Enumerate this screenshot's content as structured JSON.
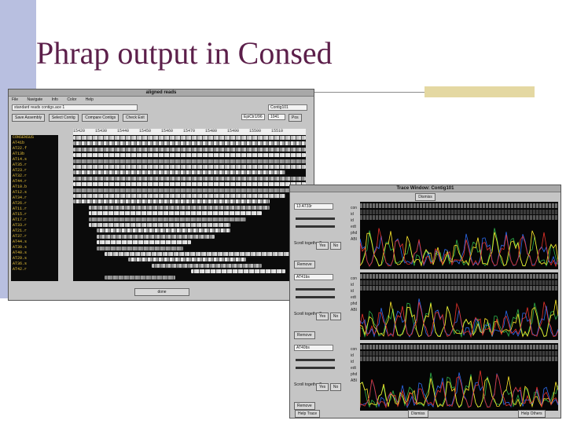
{
  "slide": {
    "title": "Phrap output in Consed"
  },
  "aligned_window": {
    "title": "aligned reads",
    "menu": [
      "File",
      "Navigate",
      "Info",
      "Color",
      "Help"
    ],
    "project_field": "standard reads contigs.ace 1",
    "contig_field": "Contig101",
    "buttons": [
      "Save Assembly",
      "Select Contig",
      "Compare Contigs",
      "Check Exit"
    ],
    "position_field": "EpiCtr1/96",
    "position_value": "1041",
    "position_button": "Pos",
    "ruler": [
      "15420",
      "15430",
      "15440",
      "15450",
      "15460",
      "15470",
      "15480",
      "15490",
      "15500",
      "15510"
    ],
    "read_names": [
      "CONSENSUS",
      "AT41b",
      "AT22.f",
      "AT13b",
      "AT14.s",
      "AT35.r",
      "AT23.r",
      "AT32.r",
      "AT44.r",
      "AT10.b",
      "AT12.s",
      "AT34.r",
      "AT26.r",
      "AT11.r",
      "AT15.r",
      "AT17.r",
      "AT33.r",
      "AT21.r",
      "AT37.r",
      "AT44.s",
      "AT30.s",
      "AT40.s",
      "AT29.s",
      "AT36.s",
      "AT42.r"
    ],
    "bottom_button": "done"
  },
  "trace_window": {
    "title": "Trace Window: Contig101",
    "top_button": "Dismiss",
    "panel_names": [
      "13 AT33r",
      "AT41bs",
      "AT40bs"
    ],
    "row_labels": [
      "con",
      "id",
      "id",
      "edt",
      "phd",
      "ABI"
    ],
    "scroll_label": "Scroll together?",
    "yes": "Yes",
    "no": "No",
    "remove": "Remove",
    "help_button": "Help Trace",
    "dismiss_button": "Dismiss",
    "help_other_button": "Help Others"
  }
}
